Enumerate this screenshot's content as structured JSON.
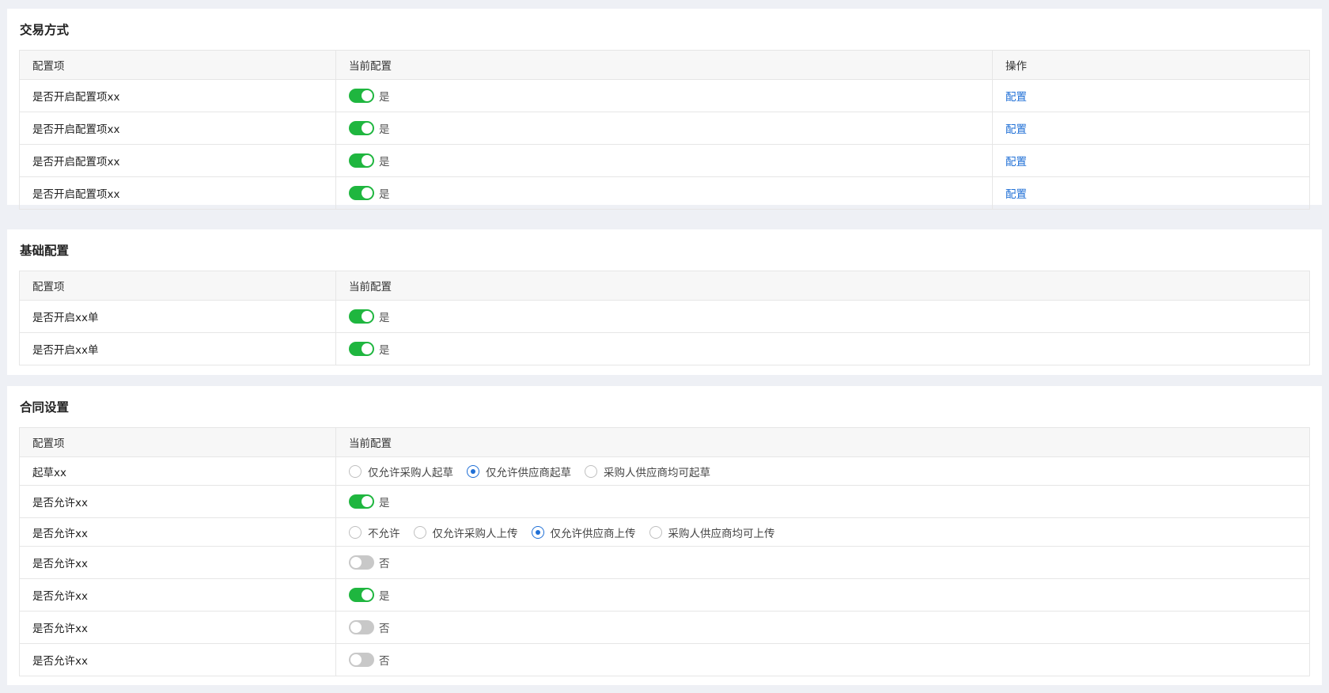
{
  "trade": {
    "title": "交易方式",
    "headers": {
      "key": "配置项",
      "current": "当前配置",
      "op": "操作"
    },
    "rows": [
      {
        "label": "是否开启配置项xx",
        "state": "是",
        "on": true,
        "op": "配置"
      },
      {
        "label": "是否开启配置项xx",
        "state": "是",
        "on": true,
        "op": "配置"
      },
      {
        "label": "是否开启配置项xx",
        "state": "是",
        "on": true,
        "op": "配置"
      },
      {
        "label": "是否开启配置项xx",
        "state": "是",
        "on": true,
        "op": "配置"
      }
    ]
  },
  "basic": {
    "title": "基础配置",
    "headers": {
      "key": "配置项",
      "current": "当前配置"
    },
    "rows": [
      {
        "label": "是否开启xx单",
        "state": "是",
        "on": true
      },
      {
        "label": "是否开启xx单",
        "state": "是",
        "on": true
      }
    ]
  },
  "contract": {
    "title": "合同设置",
    "headers": {
      "key": "配置项",
      "current": "当前配置"
    },
    "rows": [
      {
        "label": "起草xx",
        "type": "radio",
        "options": [
          "仅允许采购人起草",
          "仅允许供应商起草",
          "采购人供应商均可起草"
        ],
        "selected": 1
      },
      {
        "label": "是否允许xx",
        "type": "switch",
        "state": "是",
        "on": true
      },
      {
        "label": "是否允许xx",
        "type": "radio",
        "options": [
          "不允许",
          "仅允许采购人上传",
          "仅允许供应商上传",
          "采购人供应商均可上传"
        ],
        "selected": 2
      },
      {
        "label": "是否允许xx",
        "type": "switch",
        "state": "否",
        "on": false
      },
      {
        "label": "是否允许xx",
        "type": "switch",
        "state": "是",
        "on": true
      },
      {
        "label": "是否允许xx",
        "type": "switch",
        "state": "否",
        "on": false
      },
      {
        "label": "是否允许xx",
        "type": "switch",
        "state": "否",
        "on": false
      }
    ]
  },
  "colors": {
    "switch_on": "#1fb63f",
    "switch_off": "#c8c8c8",
    "link": "#1f6fd6",
    "radio_checked": "#1f6fd6"
  }
}
